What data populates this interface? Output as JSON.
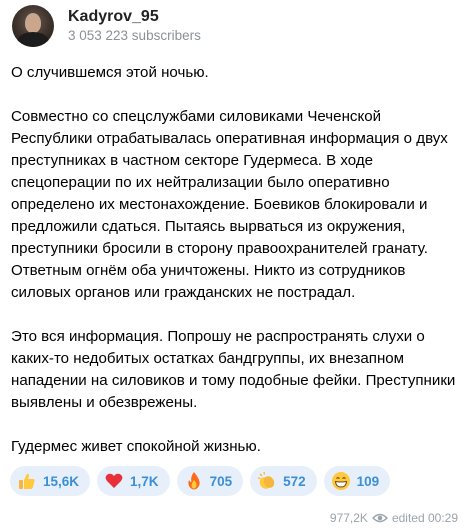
{
  "channel": {
    "name": "Kadyrov_95",
    "subscribers": "3 053 223 subscribers"
  },
  "message": {
    "paragraphs": [
      "О случившемся этой ночью.",
      "Совместно со спецслужбами силовиками Чеченской Республики отрабатывалась оперативная информация о двух преступниках в частном секторе Гудермеса. В ходе спецоперации по их нейтрализации было оперативно определено их местонахождение. Боевиков блокировали и предложили сдаться. Пытаясь вырваться из окружения, преступники бросили в сторону правоохранителей гранату. Ответным огнём оба уничтожены. Никто из сотрудников силовых органов или гражданских не пострадал.",
      "Это вся информация. Попрошу не распространять слухи о каких-то недобитых остатках бандгруппы, их внезапном нападении на силовиков и тому подобные фейки. Преступники выявлены и обезврежены.",
      "Гудермес живет спокойной жизнью."
    ]
  },
  "reactions": [
    {
      "icon": "thumbs-up-icon",
      "count": "15,6K"
    },
    {
      "icon": "red-heart-icon",
      "count": "1,7K"
    },
    {
      "icon": "fire-icon",
      "count": "705"
    },
    {
      "icon": "clapping-hands-icon",
      "count": "572"
    },
    {
      "icon": "grinning-face-icon",
      "count": "109"
    }
  ],
  "footer": {
    "views": "977,2K",
    "edited": "edited 00:29"
  },
  "colors": {
    "reaction_bg": "#e7f0fa",
    "reaction_text": "#3a8fd6",
    "meta_text": "#9aa3ab"
  }
}
